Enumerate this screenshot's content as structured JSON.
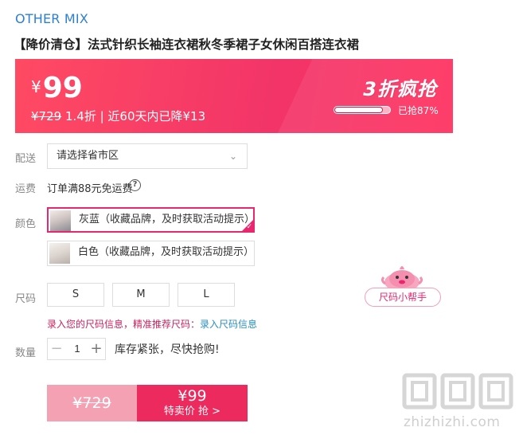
{
  "brand": "OTHER MIX",
  "title": "【降价清仓】法式针织长袖连衣裙秋冬季裙子女休闲百搭连衣裙",
  "price": {
    "currency": "¥",
    "current": "99",
    "original": "¥729",
    "discount": "1.4折",
    "sep": " | ",
    "drop_note": "近60天内已降¥13"
  },
  "promo": {
    "label": "3折疯抢",
    "progress_percent": 87,
    "progress_text": "已抢87%"
  },
  "delivery": {
    "label": "配送",
    "placeholder": "请选择省市区"
  },
  "shipping": {
    "label": "运费",
    "text": "订单满88元免运费"
  },
  "color": {
    "label": "颜色",
    "options": [
      {
        "text": "灰蓝（收藏品牌，及时获取活动提示）",
        "selected": true
      },
      {
        "text": "白色（收藏品牌，及时获取活动提示）",
        "selected": false
      }
    ]
  },
  "size": {
    "label": "尺码",
    "options": [
      "S",
      "M",
      "L"
    ],
    "hint": "录入您的尺码信息，精准推荐尺码：",
    "hint_link": "录入尺码信息",
    "helper_label": "尺码小帮手"
  },
  "quantity": {
    "label": "数量",
    "value": "1",
    "minus": "−",
    "plus": "+",
    "stock_text": "库存紧张，尽快抢购!"
  },
  "buy": {
    "original_price": "¥729",
    "price": "¥99",
    "label": "特卖价 抢 >"
  },
  "watermark": {
    "text": "zhizhizhi.com"
  },
  "colors": {
    "accent": "#ec2a5d",
    "brand_blue": "#2d7fd3",
    "link_blue": "#2a8fbd"
  }
}
